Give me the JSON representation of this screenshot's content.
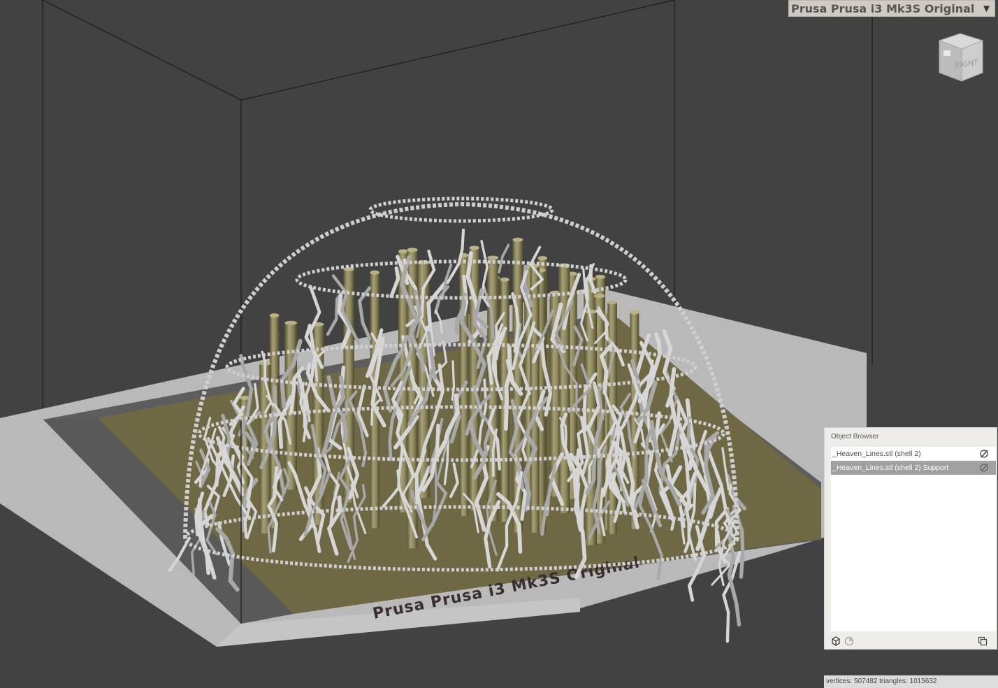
{
  "printer": {
    "name": "Prusa Prusa i3 Mk3S Original",
    "bed_label": "Prusa Prusa i3 Mk3S Original"
  },
  "viewcube": {
    "face": "RIGHT"
  },
  "object_browser": {
    "title": "Object Browser",
    "items": [
      {
        "label": "_Heaven_Lines.stl (shell 2)",
        "selected": false
      },
      {
        "label": "_Heaven_Lines.stl (shell 2) Support",
        "selected": true
      }
    ]
  },
  "status": {
    "stats": "vertices: 507482 triangles: 1015632"
  },
  "colors": {
    "background": "#424242",
    "bed": "#6e6845",
    "bed_border": "#bdbdbd",
    "support_pillars": "#8b8559",
    "support_branches": "#d2d2d2",
    "selected_row": "#a0a0a0"
  }
}
